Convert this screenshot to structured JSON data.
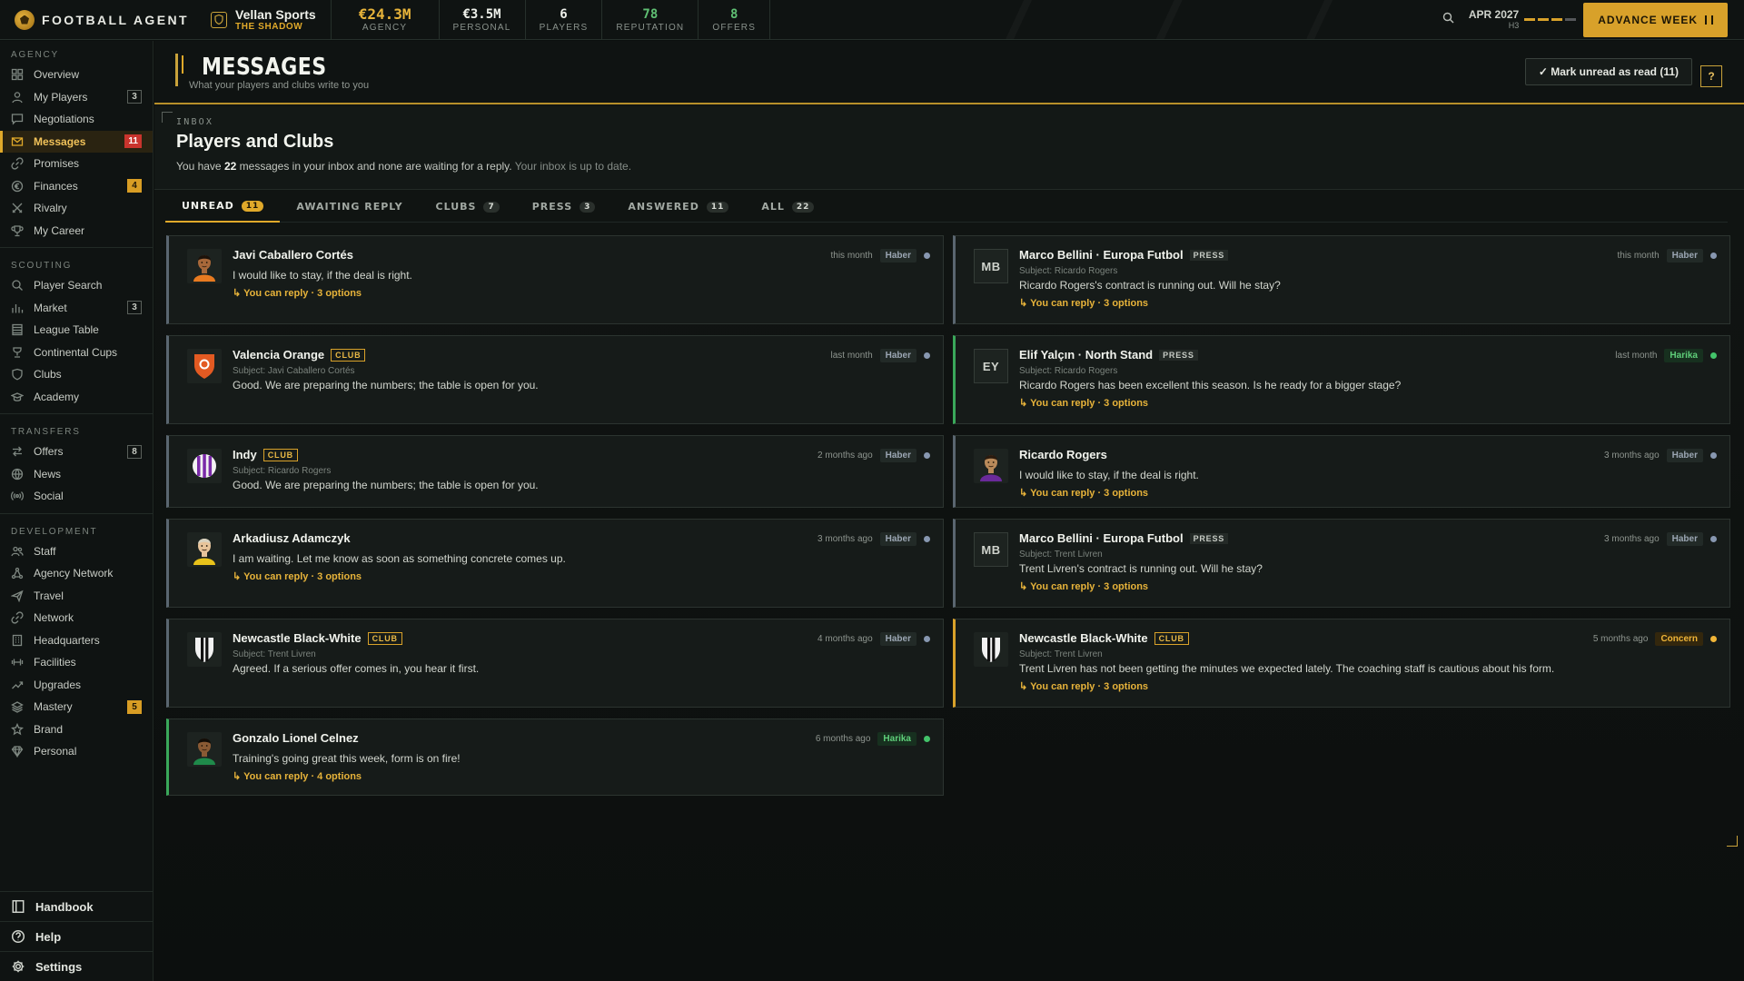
{
  "app": {
    "name": "FOOTBALL AGENT",
    "agency_name": "Vellan Sports",
    "agency_subtitle": "THE SHADOW"
  },
  "stats": [
    {
      "value": "€24.3M",
      "label": "AGENCY"
    },
    {
      "value": "€3.5M",
      "label": "PERSONAL"
    },
    {
      "value": "6",
      "label": "PLAYERS"
    },
    {
      "value": "78",
      "label": "REPUTATION"
    },
    {
      "value": "8",
      "label": "OFFERS"
    }
  ],
  "date": {
    "main": "APR 2027",
    "sub": "H3"
  },
  "advance_label": "ADVANCE WEEK",
  "sidebar": {
    "sections": [
      {
        "title": "AGENCY",
        "items": [
          {
            "label": "Overview",
            "icon": "grid-icon"
          },
          {
            "label": "My Players",
            "icon": "person-icon",
            "badge": "3"
          },
          {
            "label": "Negotiations",
            "icon": "chat-icon"
          },
          {
            "label": "Messages",
            "icon": "mail-icon",
            "badge": "11",
            "active": true
          },
          {
            "label": "Promises",
            "icon": "link-icon"
          },
          {
            "label": "Finances",
            "icon": "euro-icon",
            "badge": "4"
          },
          {
            "label": "Rivalry",
            "icon": "swords-icon"
          },
          {
            "label": "My Career",
            "icon": "trophy-icon"
          }
        ]
      },
      {
        "title": "SCOUTING",
        "items": [
          {
            "label": "Player Search",
            "icon": "search-icon"
          },
          {
            "label": "Market",
            "icon": "bar-chart-icon",
            "badge": "3"
          },
          {
            "label": "League Table",
            "icon": "table-icon"
          },
          {
            "label": "Continental Cups",
            "icon": "cup-icon"
          },
          {
            "label": "Clubs",
            "icon": "shield-icon"
          },
          {
            "label": "Academy",
            "icon": "graduation-icon"
          }
        ]
      },
      {
        "title": "TRANSFERS",
        "items": [
          {
            "label": "Offers",
            "icon": "swap-icon",
            "badge": "8"
          },
          {
            "label": "News",
            "icon": "globe-icon"
          },
          {
            "label": "Social",
            "icon": "broadcast-icon"
          }
        ]
      },
      {
        "title": "DEVELOPMENT",
        "items": [
          {
            "label": "Staff",
            "icon": "people-icon"
          },
          {
            "label": "Agency Network",
            "icon": "network-icon"
          },
          {
            "label": "Travel",
            "icon": "plane-icon"
          },
          {
            "label": "Network",
            "icon": "link-icon"
          },
          {
            "label": "Headquarters",
            "icon": "building-icon"
          },
          {
            "label": "Facilities",
            "icon": "dumbbell-icon"
          },
          {
            "label": "Upgrades",
            "icon": "trend-icon"
          },
          {
            "label": "Mastery",
            "icon": "layers-icon",
            "badge": "5"
          },
          {
            "label": "Brand",
            "icon": "star-icon"
          },
          {
            "label": "Personal",
            "icon": "diamond-icon"
          }
        ]
      }
    ],
    "bottom": [
      {
        "label": "Handbook",
        "icon": "book-icon"
      },
      {
        "label": "Help",
        "icon": "help-icon"
      },
      {
        "label": "Settings",
        "icon": "gear-icon"
      }
    ]
  },
  "page": {
    "title": "MESSAGES",
    "subtitle": "What your players and clubs write to you",
    "mark_read": "✓ Mark unread as read (11)",
    "help": "?"
  },
  "inbox": {
    "kicker": "INBOX",
    "title": "Players and Clubs",
    "desc_prefix": "You have",
    "desc_count": "22",
    "desc_mid": "messages in your inbox and none are waiting for a reply.",
    "desc_tail": "Your inbox is up to date."
  },
  "tabs": [
    {
      "label": "UNREAD",
      "count": "11",
      "active": true
    },
    {
      "label": "AWAITING REPLY"
    },
    {
      "label": "CLUBS",
      "count": "7"
    },
    {
      "label": "PRESS",
      "count": "3"
    },
    {
      "label": "ANSWERED",
      "count": "11"
    },
    {
      "label": "ALL",
      "count": "22"
    }
  ],
  "messages": [
    {
      "col": 0,
      "name": "Javi Caballero Cortés",
      "avatar": "face-orange",
      "time": "this month",
      "status": "Haber",
      "body": "I would like to stay, if the deal is right.",
      "reply": "↳ You can reply · 3 options"
    },
    {
      "col": 1,
      "name": "Marco Bellini · Europa Futbol",
      "tag": "PRESS",
      "avatar": "MB",
      "time": "this month",
      "status": "Haber",
      "subject": "Subject: Ricardo Rogers",
      "body": "Ricardo Rogers's contract is running out. Will he stay?",
      "reply": "↳ You can reply · 3 options"
    },
    {
      "col": 0,
      "name": "Valencia Orange",
      "tag": "CLUB",
      "avatar": "crest-orange",
      "time": "last month",
      "status": "Haber",
      "subject": "Subject: Javi Caballero Cortés",
      "body": "Good. We are preparing the numbers; the table is open for you."
    },
    {
      "col": 1,
      "name": "Elif Yalçın · North Stand",
      "tag": "PRESS",
      "avatar": "EY",
      "time": "last month",
      "status": "Harika",
      "subject": "Subject: Ricardo Rogers",
      "body": "Ricardo Rogers has been excellent this season. Is he ready for a bigger stage?",
      "reply": "↳ You can reply · 3 options"
    },
    {
      "col": 0,
      "name": "Indy",
      "tag": "CLUB",
      "avatar": "crest-purple",
      "time": "2 months ago",
      "status": "Haber",
      "subject": "Subject: Ricardo Rogers",
      "body": "Good. We are preparing the numbers; the table is open for you."
    },
    {
      "col": 1,
      "name": "Ricardo Rogers",
      "avatar": "face-purple",
      "time": "3 months ago",
      "status": "Haber",
      "body": "I would like to stay, if the deal is right.",
      "reply": "↳ You can reply · 3 options"
    },
    {
      "col": 0,
      "name": "Arkadiusz Adamczyk",
      "avatar": "face-yellow",
      "time": "3 months ago",
      "status": "Haber",
      "body": "I am waiting. Let me know as soon as something concrete comes up.",
      "reply": "↳ You can reply · 3 options"
    },
    {
      "col": 1,
      "name": "Marco Bellini · Europa Futbol",
      "tag": "PRESS",
      "avatar": "MB",
      "time": "3 months ago",
      "status": "Haber",
      "subject": "Subject: Trent Livren",
      "body": "Trent Livren's contract is running out. Will he stay?",
      "reply": "↳ You can reply · 3 options"
    },
    {
      "col": 0,
      "name": "Newcastle Black-White",
      "tag": "CLUB",
      "avatar": "crest-bw",
      "time": "4 months ago",
      "status": "Haber",
      "subject": "Subject: Trent Livren",
      "body": "Agreed. If a serious offer comes in, you hear it first."
    },
    {
      "col": 1,
      "name": "Newcastle Black-White",
      "tag": "CLUB",
      "avatar": "crest-bw",
      "time": "5 months ago",
      "status": "Concern",
      "subject": "Subject: Trent Livren",
      "body": "Trent Livren has not been getting the minutes we expected lately. The coaching staff is cautious about his form.",
      "reply": "↳ You can reply · 3 options"
    },
    {
      "col": 0,
      "name": "Gonzalo Lionel Celnez",
      "avatar": "face-green",
      "time": "6 months ago",
      "status": "Harika",
      "body": "Training's going great this week, form is on fire!",
      "reply": "↳ You can reply · 4 options"
    }
  ]
}
